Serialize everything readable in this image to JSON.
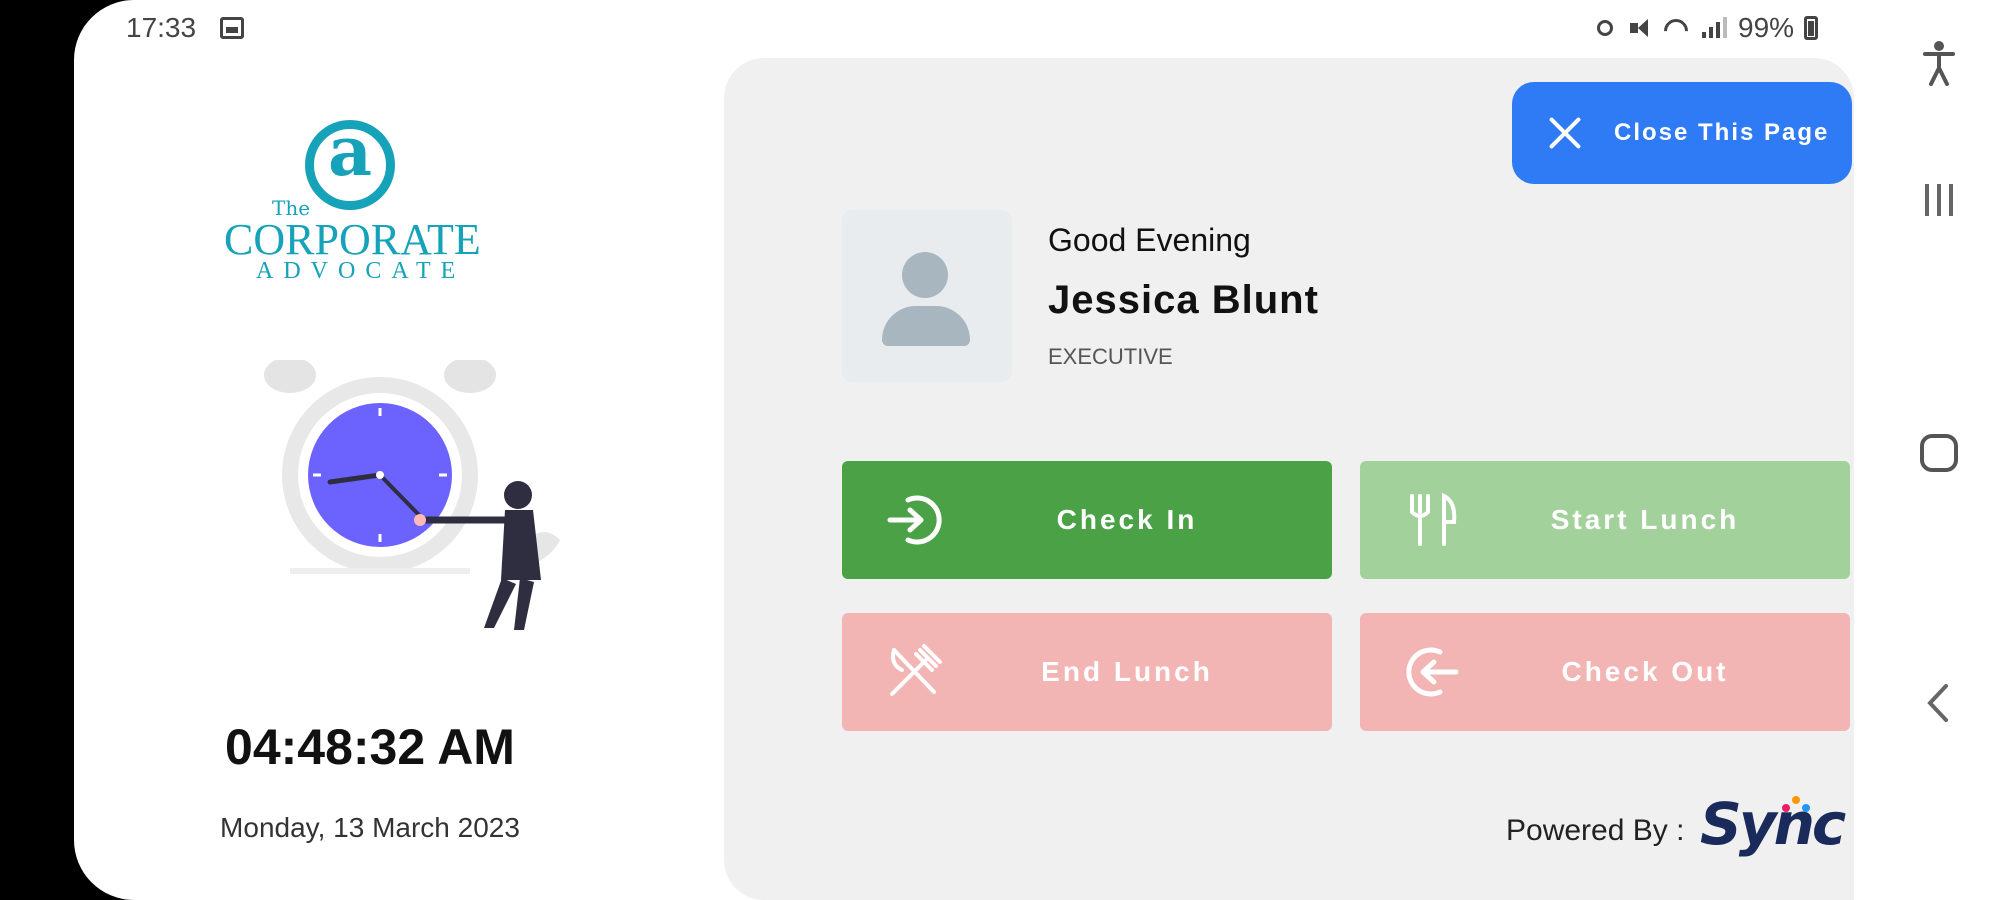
{
  "status_bar": {
    "time": "17:33",
    "battery": "99%"
  },
  "logo": {
    "mark": "a",
    "the": "The",
    "line1": "CORPORATE",
    "line2": "ADVOCATE"
  },
  "clock": {
    "time": "04:48:32 AM",
    "date": "Monday, 13 March 2023"
  },
  "close_button": {
    "label": "Close This Page",
    "icon": "close-icon"
  },
  "user": {
    "greeting": "Good Evening",
    "name": "Jessica Blunt",
    "role": "EXECUTIVE",
    "avatar_icon": "person-placeholder-icon"
  },
  "actions": [
    {
      "label": "Check In",
      "icon": "login-arrow-icon",
      "color": "#4ba146",
      "enabled": true
    },
    {
      "label": "Start Lunch",
      "icon": "fork-knife-icon",
      "color": "#a3d19b",
      "enabled": false
    },
    {
      "label": "End Lunch",
      "icon": "crossed-utensils-icon",
      "color": "#f3b4b4",
      "enabled": false
    },
    {
      "label": "Check Out",
      "icon": "logout-arrow-icon",
      "color": "#f3b4b4",
      "enabled": false
    }
  ],
  "footer": {
    "powered_by": "Powered By :",
    "brand": "Sync"
  },
  "colors": {
    "accent_blue": "#2f7af5",
    "logo_teal": "#16a2b8",
    "clock_face": "#6c63ff"
  }
}
